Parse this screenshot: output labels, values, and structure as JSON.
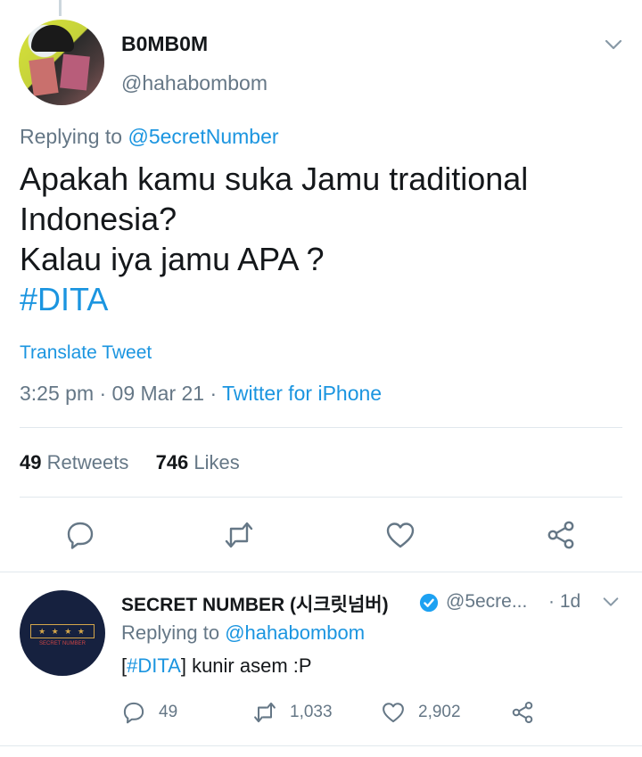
{
  "tweet": {
    "author_name": "B0MB0M",
    "author_handle": "@hahabombom",
    "replying_prefix": "Replying to",
    "replying_to": "@5ecretNumber",
    "text_lines": [
      "Apakah kamu suka Jamu traditional",
      "Indonesia?",
      "Kalau iya jamu APA ?"
    ],
    "hashtag": "#DITA",
    "translate_label": "Translate Tweet",
    "timestamp": "3:25 pm · 09 Mar 21 · ",
    "source": "Twitter for iPhone",
    "retweets_count": "49",
    "retweets_label": "Retweets",
    "likes_count": "746",
    "likes_label": "Likes"
  },
  "actions": [
    "reply-icon",
    "retweet-icon",
    "like-icon",
    "share-icon"
  ],
  "reply": {
    "author_name": "SECRET NUMBER (시크릿넘버)",
    "author_handle": "@5ecre...",
    "time": "· 1d",
    "replying_prefix": "Replying to",
    "replying_to": "@hahabombom",
    "text_open": "[",
    "hashtag": "#DITA",
    "text_rest": "] kunir asem :P",
    "reply_count": "49",
    "retweet_count": "1,033",
    "like_count": "2,902",
    "avatar_stars": "★ ★ ★ ★",
    "avatar_brand": "SECRET NUMBER"
  },
  "colors": {
    "link": "#1b95e0",
    "muted": "#657786",
    "text": "#14171a",
    "verified": "#1da1f2"
  }
}
